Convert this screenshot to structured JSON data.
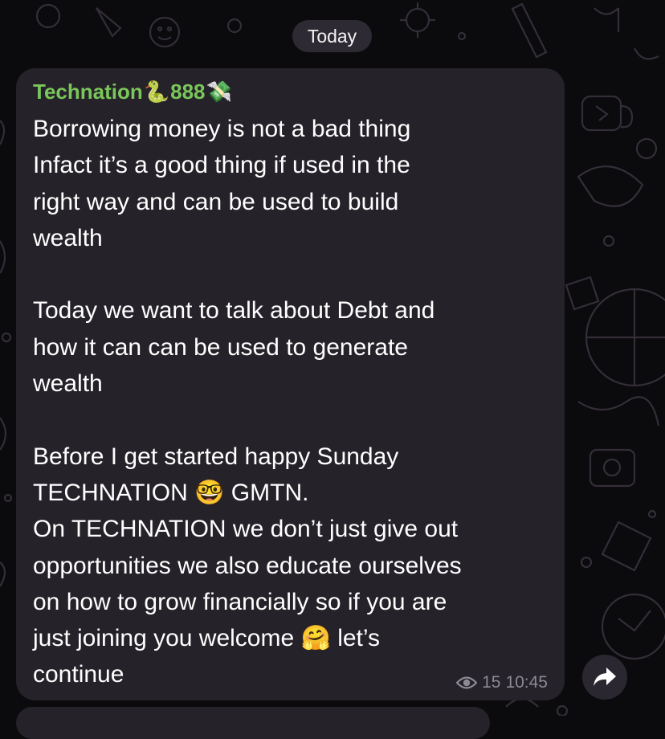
{
  "date_separator": "Today",
  "message": {
    "sender_name": "Technation",
    "sender_emoji_1": "🐍",
    "sender_digits": "888",
    "sender_emoji_2": "💸",
    "lines": [
      "Borrowing money is not a bad thing",
      "Infact it’s a good thing if used in the",
      "right way and can be used to build",
      "wealth",
      "Today we want to talk about Debt and",
      "how it can can be used to generate",
      "wealth",
      "Before I get started happy Sunday",
      "TECHNATION 🤓 GMTN.",
      "On TECHNATION we don’t just give out",
      "opportunities we also educate ourselves",
      "on how to grow financially so if you are",
      "just joining you welcome 🤗 let’s",
      "continue"
    ],
    "views": "15",
    "time": "10:45"
  },
  "icons": {
    "views": "eye-icon",
    "share": "forward-arrow-icon"
  },
  "colors": {
    "background": "#0b0a0d",
    "bubble": "#262229",
    "sender": "#79c75a",
    "text": "#ffffff",
    "meta": "#8e8a94"
  }
}
